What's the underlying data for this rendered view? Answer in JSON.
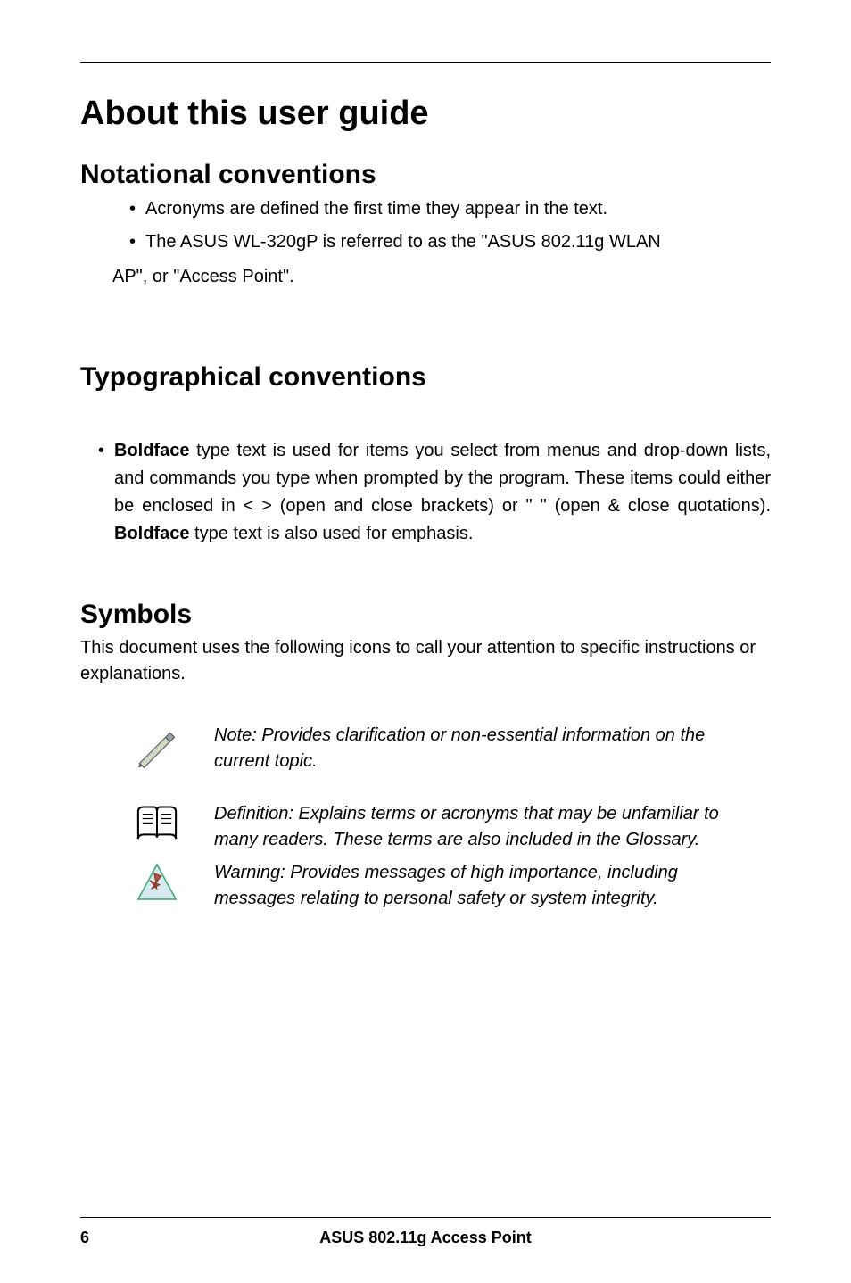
{
  "title": "About this user guide",
  "sections": {
    "notational": {
      "heading": "Notational conventions",
      "items": [
        "Acronyms are defined the first time they appear in the text.",
        "The ASUS WL-320gP is referred to as the \"ASUS 802.11g WLAN"
      ],
      "continuation": "AP\", or \"Access Point\"."
    },
    "typographical": {
      "heading": "Typographical conventions",
      "item_prefix_bold": "Boldface",
      "item_mid": " type text is used for items you select from menus and drop-down lists, and commands you type when prompted by the program. These items could either be enclosed in < > (open and close brackets) or \" \" (open & close quotations). ",
      "item_bold2": "Boldface",
      "item_suffix": " type text is also used for emphasis."
    },
    "symbols": {
      "heading": "Symbols",
      "intro": "This document uses the following icons to call your attention to specific instructions or explanations.",
      "rows": [
        "Note: Provides clarification or non-essential information on the current topic.",
        "Definition: Explains terms or acronyms that may be unfamiliar to many readers. These terms are also included in the Glossary.",
        "Warning: Provides messages of high importance, including messages relating to personal safety or system integrity."
      ]
    }
  },
  "footer": {
    "page": "6",
    "title": "ASUS 802.11g Access Point"
  }
}
